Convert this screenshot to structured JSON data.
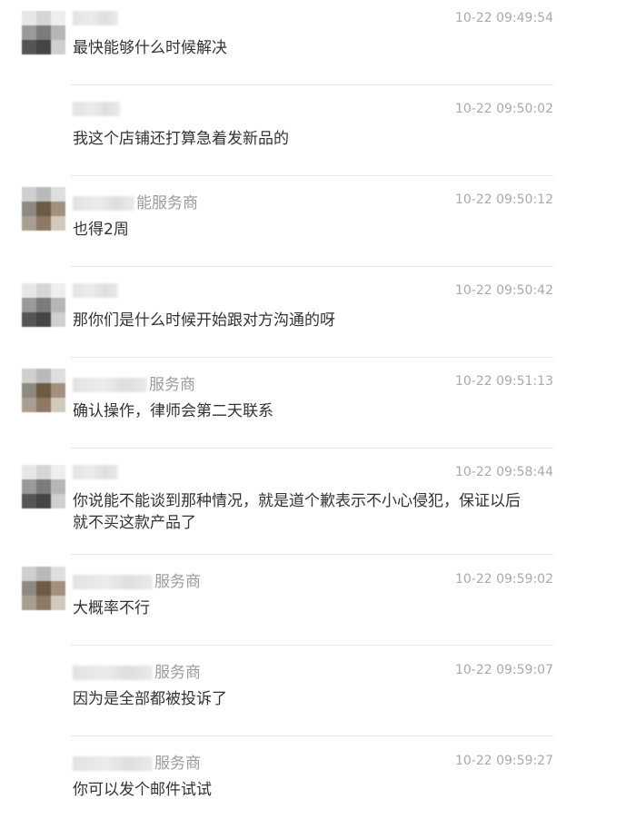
{
  "messages": [
    {
      "name_suffix": "",
      "time": "10-22 09:49:54",
      "text": "最快能够什么时候解决"
    },
    {
      "name_suffix": "",
      "time": "10-22 09:50:02",
      "text": "我这个店铺还打算急着发新品的"
    },
    {
      "name_suffix": "能服务商",
      "time": "10-22 09:50:12",
      "text": "也得2周"
    },
    {
      "name_suffix": "",
      "time": "10-22 09:50:42",
      "text": "那你们是什么时候开始跟对方沟通的呀"
    },
    {
      "name_suffix": "服务商",
      "time": "10-22 09:51:13",
      "text": "确认操作，律师会第二天联系"
    },
    {
      "name_suffix": "",
      "time": "10-22 09:58:44",
      "text": "你说能不能谈到那种情况，就是道个歉表示不小心侵犯，保证以后就不买这款产品了"
    },
    {
      "name_suffix": "服务商",
      "time": "10-22 09:59:02",
      "text": "大概率不行"
    },
    {
      "name_suffix": "服务商",
      "time": "10-22 09:59:07",
      "text": "因为是全部都被投诉了"
    },
    {
      "name_suffix": "服务商",
      "time": "10-22 09:59:27",
      "text": "你可以发个邮件试试"
    }
  ]
}
